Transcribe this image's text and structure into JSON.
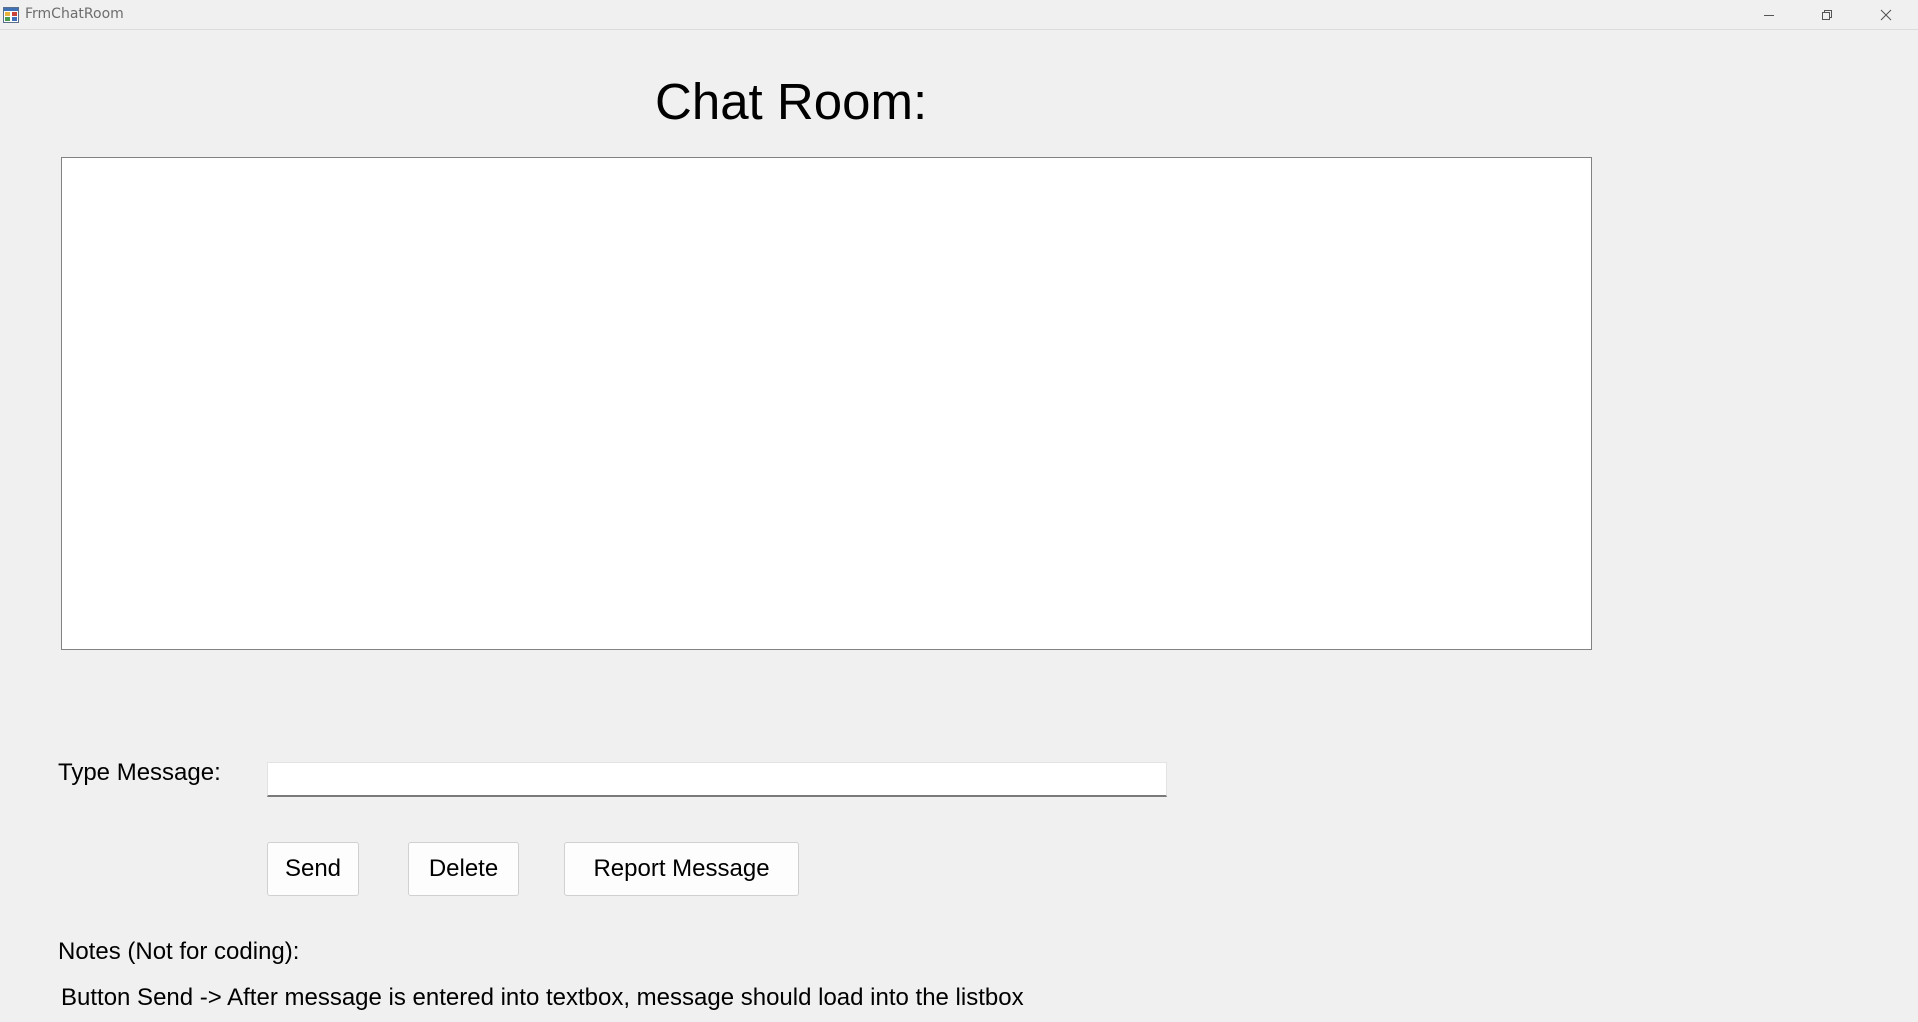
{
  "window": {
    "title": "FrmChatRoom",
    "icon": "winforms-app-icon",
    "controls": [
      "minimize-icon",
      "restore-icon",
      "close-icon"
    ]
  },
  "heading": "Chat Room:",
  "chat_list": {
    "items": []
  },
  "message": {
    "label": "Type Message:",
    "value": "",
    "placeholder": ""
  },
  "buttons": {
    "send": "Send",
    "delete": "Delete",
    "report": "Report Message"
  },
  "notes": {
    "label": "Notes (Not for coding):",
    "lines": [
      "Button Send -> After message is entered into textbox, message should load into the listbox"
    ]
  }
}
